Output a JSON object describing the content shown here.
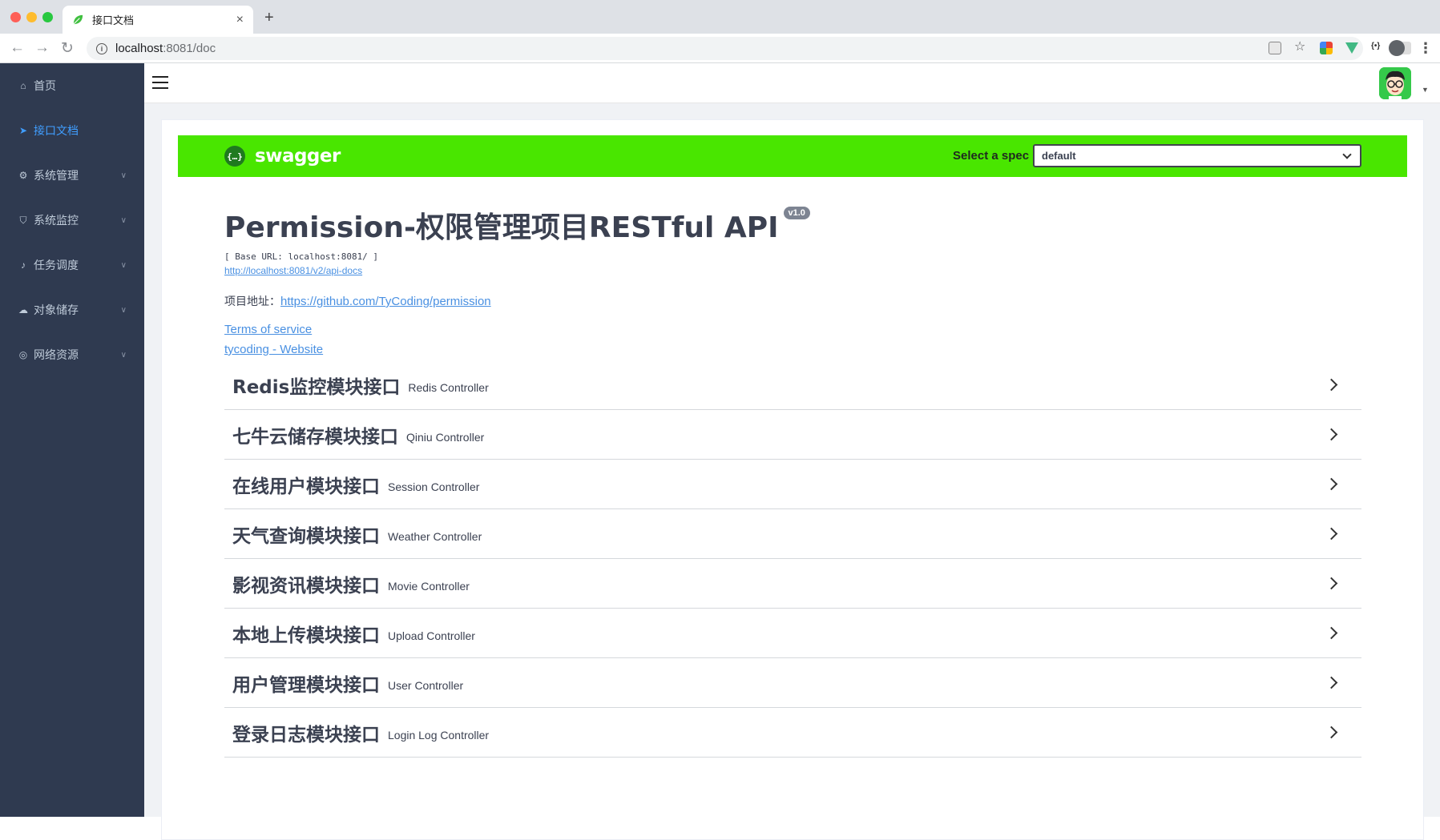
{
  "browser": {
    "tab_title": "接口文档",
    "url_host": "localhost",
    "url_rest": ":8081/doc"
  },
  "sidebar": {
    "items": [
      {
        "label": "首页",
        "icon": "home-icon",
        "expandable": false,
        "active": false
      },
      {
        "label": "接口文档",
        "icon": "send-icon",
        "expandable": false,
        "active": true
      },
      {
        "label": "系统管理",
        "icon": "gear-icon",
        "expandable": true,
        "active": false
      },
      {
        "label": "系统监控",
        "icon": "shield-icon",
        "expandable": true,
        "active": false
      },
      {
        "label": "任务调度",
        "icon": "bell-icon",
        "expandable": true,
        "active": false
      },
      {
        "label": "对象储存",
        "icon": "cloud-icon",
        "expandable": true,
        "active": false
      },
      {
        "label": "网络资源",
        "icon": "globe-icon",
        "expandable": true,
        "active": false
      }
    ]
  },
  "swagger": {
    "logo_text": "swagger",
    "logo_mark": "{…}",
    "spec_label": "Select a spec",
    "spec_value": "default",
    "title": "Permission-权限管理项目RESTful API",
    "version": "v1.0",
    "base_url": "[ Base URL: localhost:8081/ ]",
    "api_docs_link": "http://localhost:8081/v2/api-docs",
    "project_label": "项目地址：",
    "project_link": "https://github.com/TyCoding/permission",
    "terms_link": "Terms of service",
    "website_link": "tycoding - Website",
    "tags": [
      {
        "name": "Redis监控模块接口",
        "desc": "Redis Controller"
      },
      {
        "name": "七牛云储存模块接口",
        "desc": "Qiniu Controller"
      },
      {
        "name": "在线用户模块接口",
        "desc": "Session Controller"
      },
      {
        "name": "天气查询模块接口",
        "desc": "Weather Controller"
      },
      {
        "name": "影视资讯模块接口",
        "desc": "Movie Controller"
      },
      {
        "name": "本地上传模块接口",
        "desc": "Upload Controller"
      },
      {
        "name": "用户管理模块接口",
        "desc": "User Controller"
      },
      {
        "name": "登录日志模块接口",
        "desc": "Login Log Controller"
      }
    ]
  },
  "colors": {
    "sidebar_bg": "#2f3a50",
    "sidebar_active": "#409eff",
    "swagger_bar": "#49e600",
    "link": "#4990e2"
  }
}
